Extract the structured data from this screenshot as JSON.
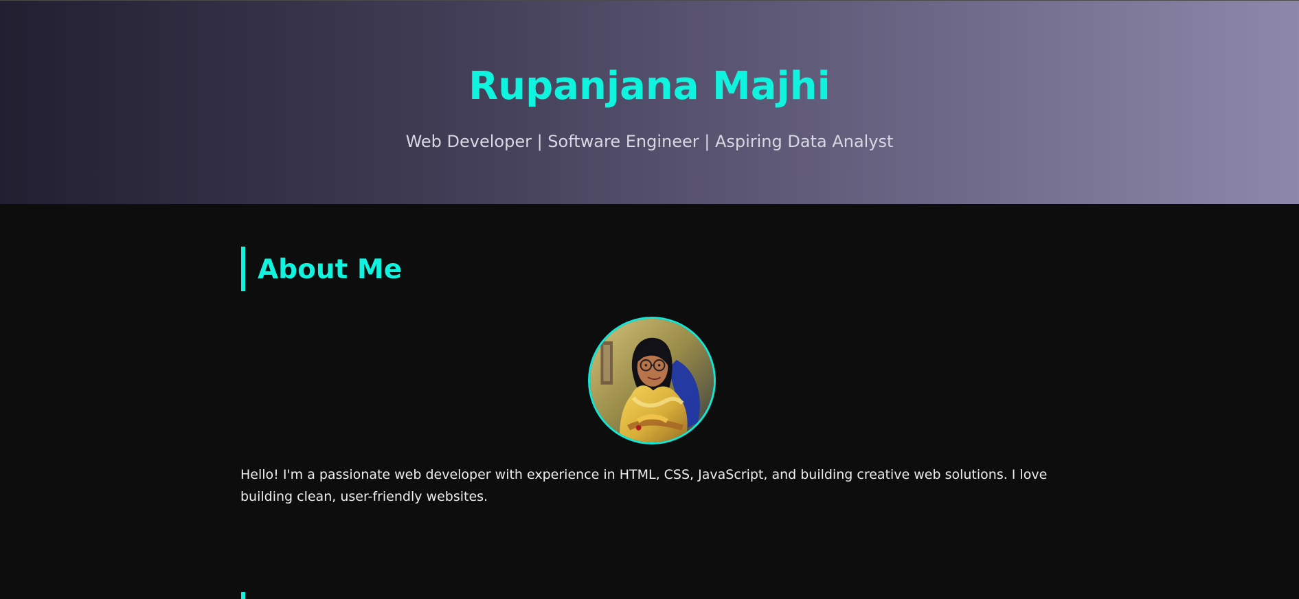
{
  "header": {
    "title": "Rupanjana Majhi",
    "subtitle": "Web Developer | Software Engineer | Aspiring Data Analyst"
  },
  "about": {
    "heading": "About Me",
    "profile_image_alt": "Profile photo of Rupanjana Majhi",
    "text": "Hello! I'm a passionate web developer with experience in HTML, CSS, JavaScript, and building creative web solutions. I love building clean, user-friendly websites."
  },
  "colors": {
    "accent": "#0ff3df",
    "background": "#0d0d0d",
    "hero_gradient_start": "#221f31",
    "hero_gradient_end": "#8d87aa",
    "body_text": "#efefef",
    "subtitle_text": "#d8d8e2"
  }
}
